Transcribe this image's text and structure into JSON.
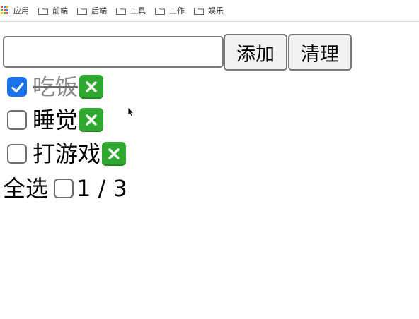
{
  "bookmarks": {
    "items": [
      {
        "label": "应用",
        "icon": "apps-grid-icon"
      },
      {
        "label": "前端",
        "icon": "folder-icon"
      },
      {
        "label": "后端",
        "icon": "folder-icon"
      },
      {
        "label": "工具",
        "icon": "folder-icon"
      },
      {
        "label": "工作",
        "icon": "folder-icon"
      },
      {
        "label": "娱乐",
        "icon": "folder-icon"
      }
    ]
  },
  "todo": {
    "input_value": "",
    "add_label": "添加",
    "clear_label": "清理",
    "items": [
      {
        "label": "吃饭",
        "checked": true
      },
      {
        "label": "睡觉",
        "checked": false
      },
      {
        "label": "打游戏",
        "checked": false
      }
    ],
    "delete_icon": "cross-mark-icon",
    "select_all_label": "全选",
    "select_all_checked": false,
    "count_text": "1 / 3"
  },
  "colors": {
    "checkbox_checked": "#1a73e8",
    "delete_button": "#2fa82f",
    "done_text": "#8a8a8a"
  }
}
